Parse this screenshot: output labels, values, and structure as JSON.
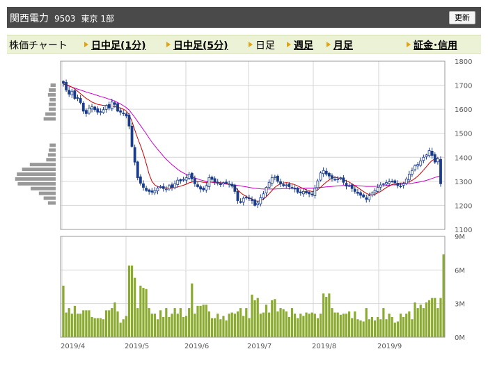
{
  "header": {
    "name": "関西電力",
    "code": "9503",
    "market": "東京 1部",
    "refresh_label": "更新"
  },
  "menu": {
    "title": "株価チャート",
    "items": [
      {
        "label": "日中足(1分)",
        "link": true
      },
      {
        "label": "日中足(5分)",
        "link": true
      },
      {
        "label": "日足",
        "link": false
      },
      {
        "label": "週足",
        "link": true
      },
      {
        "label": "月足",
        "link": true
      },
      {
        "label": "証金･信用",
        "link": true
      }
    ]
  },
  "colors": {
    "candle_up": "#ffffff",
    "candle_down": "#1a3c8c",
    "ma_short": "#cc0000",
    "ma_long": "#cc00cc",
    "volume_bar": "#8aab30",
    "volume_profile": "#999999",
    "grid": "#d6d6d6"
  },
  "chart_data": [
    {
      "type": "candlestick",
      "ylim": [
        1100,
        1800
      ],
      "yticks": [
        1100,
        1200,
        1300,
        1400,
        1500,
        1600,
        1700,
        1800
      ],
      "x_dates": [
        "2019/4",
        "2019/5",
        "2019/6",
        "2019/7",
        "2019/8",
        "2019/9"
      ],
      "grid": true,
      "close": [
        1708,
        1680,
        1663,
        1675,
        1645,
        1648,
        1628,
        1592,
        1582,
        1605,
        1610,
        1598,
        1588,
        1590,
        1598,
        1616,
        1605,
        1630,
        1620,
        1592,
        1588,
        1582,
        1572,
        1530,
        1445,
        1380,
        1315,
        1292,
        1275,
        1262,
        1258,
        1255,
        1262,
        1272,
        1278,
        1270,
        1268,
        1282,
        1275,
        1290,
        1305,
        1302,
        1308,
        1315,
        1330,
        1310,
        1290,
        1278,
        1268,
        1265,
        1282,
        1316,
        1308,
        1299,
        1292,
        1287,
        1295,
        1292,
        1289,
        1280,
        1258,
        1220,
        1212,
        1230,
        1233,
        1228,
        1220,
        1200,
        1210,
        1232,
        1248,
        1275,
        1296,
        1315,
        1318,
        1300,
        1290,
        1282,
        1285,
        1278,
        1274,
        1268,
        1255,
        1252,
        1258,
        1252,
        1248,
        1244,
        1272,
        1302,
        1335,
        1345,
        1330,
        1322,
        1312,
        1308,
        1310,
        1315,
        1296,
        1280,
        1282,
        1270,
        1258,
        1250,
        1242,
        1235,
        1225,
        1240,
        1252,
        1262,
        1275,
        1285,
        1290,
        1295,
        1298,
        1300,
        1295,
        1282,
        1280,
        1290,
        1310,
        1330,
        1345,
        1365,
        1370,
        1385,
        1400,
        1410,
        1428,
        1408,
        1380,
        1395,
        1290
      ],
      "ma_short": [
        1705,
        1702,
        1698,
        1692,
        1685,
        1675,
        1665,
        1655,
        1645,
        1638,
        1630,
        1625,
        1620,
        1618,
        1616,
        1615,
        1614,
        1612,
        1611,
        1608,
        1605,
        1600,
        1593,
        1578,
        1550,
        1513,
        1479,
        1448,
        1414,
        1374,
        1330,
        1300,
        1285,
        1278,
        1275,
        1274,
        1273,
        1273,
        1273,
        1274,
        1277,
        1280,
        1284,
        1288,
        1294,
        1297,
        1299,
        1299,
        1298,
        1296,
        1296,
        1297,
        1297,
        1297,
        1296,
        1294,
        1293,
        1291,
        1288,
        1283,
        1276,
        1264,
        1253,
        1244,
        1237,
        1232,
        1227,
        1220,
        1217,
        1220,
        1226,
        1236,
        1249,
        1262,
        1275,
        1284,
        1290,
        1293,
        1295,
        1293,
        1290,
        1286,
        1281,
        1275,
        1270,
        1265,
        1261,
        1258,
        1259,
        1265,
        1275,
        1287,
        1297,
        1306,
        1315,
        1317,
        1315,
        1311,
        1307,
        1302,
        1297,
        1290,
        1282,
        1274,
        1266,
        1258,
        1250,
        1245,
        1243,
        1246,
        1252,
        1258,
        1266,
        1274,
        1281,
        1287,
        1291,
        1292,
        1293,
        1293,
        1295,
        1298,
        1304,
        1312,
        1322,
        1334,
        1347,
        1361,
        1375,
        1387,
        1393,
        1398,
        1375
      ],
      "ma_long": [
        1705,
        1700,
        1696,
        1692,
        1688,
        1684,
        1680,
        1676,
        1672,
        1668,
        1665,
        1661,
        1657,
        1653,
        1650,
        1646,
        1642,
        1638,
        1634,
        1628,
        1622,
        1615,
        1607,
        1597,
        1582,
        1566,
        1549,
        1532,
        1515,
        1498,
        1480,
        1463,
        1448,
        1433,
        1419,
        1405,
        1392,
        1381,
        1370,
        1360,
        1350,
        1342,
        1335,
        1329,
        1323,
        1318,
        1314,
        1310,
        1306,
        1303,
        1300,
        1298,
        1296,
        1294,
        1293,
        1291,
        1290,
        1289,
        1288,
        1286,
        1285,
        1283,
        1281,
        1279,
        1277,
        1275,
        1273,
        1271,
        1270,
        1269,
        1268,
        1268,
        1268,
        1268,
        1268,
        1269,
        1269,
        1270,
        1270,
        1270,
        1271,
        1271,
        1271,
        1271,
        1271,
        1272,
        1272,
        1272,
        1273,
        1274,
        1275,
        1276,
        1277,
        1278,
        1279,
        1280,
        1281,
        1282,
        1283,
        1283,
        1283,
        1283,
        1283,
        1282,
        1281,
        1280,
        1279,
        1279,
        1279,
        1279,
        1280,
        1281,
        1282,
        1283,
        1284,
        1285,
        1286,
        1287,
        1288,
        1289,
        1290,
        1291,
        1292,
        1294,
        1296,
        1298,
        1301,
        1304,
        1308,
        1312,
        1316,
        1320,
        1322
      ]
    },
    {
      "type": "bar",
      "ylim": [
        0,
        9
      ],
      "yticks": [
        "0M",
        "3M",
        "6M",
        "9M"
      ],
      "values": [
        4.6,
        2.2,
        2.6,
        2.1,
        2.8,
        2.1,
        2.1,
        2.4,
        2.4,
        2.4,
        1.8,
        1.7,
        1.7,
        1.7,
        1.6,
        2.4,
        2.4,
        2.6,
        3.1,
        2.3,
        1.3,
        1.6,
        1.9,
        6.4,
        6.4,
        5.3,
        2.6,
        4.6,
        4.4,
        4.3,
        2.6,
        2.1,
        2.1,
        1.6,
        2.4,
        1.8,
        2.6,
        1.8,
        2.1,
        2.6,
        2.1,
        2.6,
        1.8,
        1.9,
        2.6,
        4.8,
        2.1,
        2.8,
        2.8,
        2.9,
        2.9,
        2.3,
        1.7,
        1.7,
        2.1,
        1.6,
        1.9,
        1.5,
        2.1,
        2.2,
        2.1,
        2.3,
        2.6,
        1.9,
        2.6,
        1.7,
        3.8,
        3.3,
        3.5,
        2.1,
        2.2,
        2.9,
        2.2,
        3.3,
        3.4,
        2.3,
        2.6,
        2.5,
        2.3,
        1.8,
        2.6,
        2.1,
        1.7,
        2.1,
        1.9,
        2.2,
        2.1,
        2.2,
        2.1,
        1.7,
        2.1,
        3.9,
        3.6,
        3.9,
        2.6,
        2.2,
        2.2,
        2.0,
        2.1,
        2.1,
        2.3,
        1.7,
        2.3,
        1.6,
        1.5,
        1.4,
        2.6,
        1.6,
        1.8,
        1.5,
        1.8,
        1.6,
        2.6,
        1.6,
        2.1,
        1.8,
        1.3,
        1.4,
        2.1,
        1.8,
        2.1,
        2.3,
        1.6,
        3.1,
        2.6,
        2.9,
        2.6,
        3.1,
        3.3,
        3.5,
        3.5,
        2.6,
        3.5,
        7.4
      ],
      "x_dates": [
        "2019/4",
        "2019/5",
        "2019/6",
        "2019/7",
        "2019/8",
        "2019/9"
      ]
    },
    {
      "type": "bar",
      "orientation": "horizontal",
      "price_levels": [
        1210,
        1230,
        1250,
        1270,
        1290,
        1310,
        1330,
        1350,
        1370,
        1390,
        1410,
        1430,
        1450,
        1560,
        1580,
        1600,
        1620,
        1640,
        1660,
        1680,
        1700
      ],
      "values": [
        0.18,
        0.28,
        0.39,
        0.58,
        0.88,
        0.94,
        0.9,
        0.78,
        0.6,
        0.22,
        0.18,
        0.16,
        0.14,
        0.28,
        0.24,
        0.16,
        0.16,
        0.14,
        0.18,
        0.16,
        0.12
      ]
    }
  ]
}
